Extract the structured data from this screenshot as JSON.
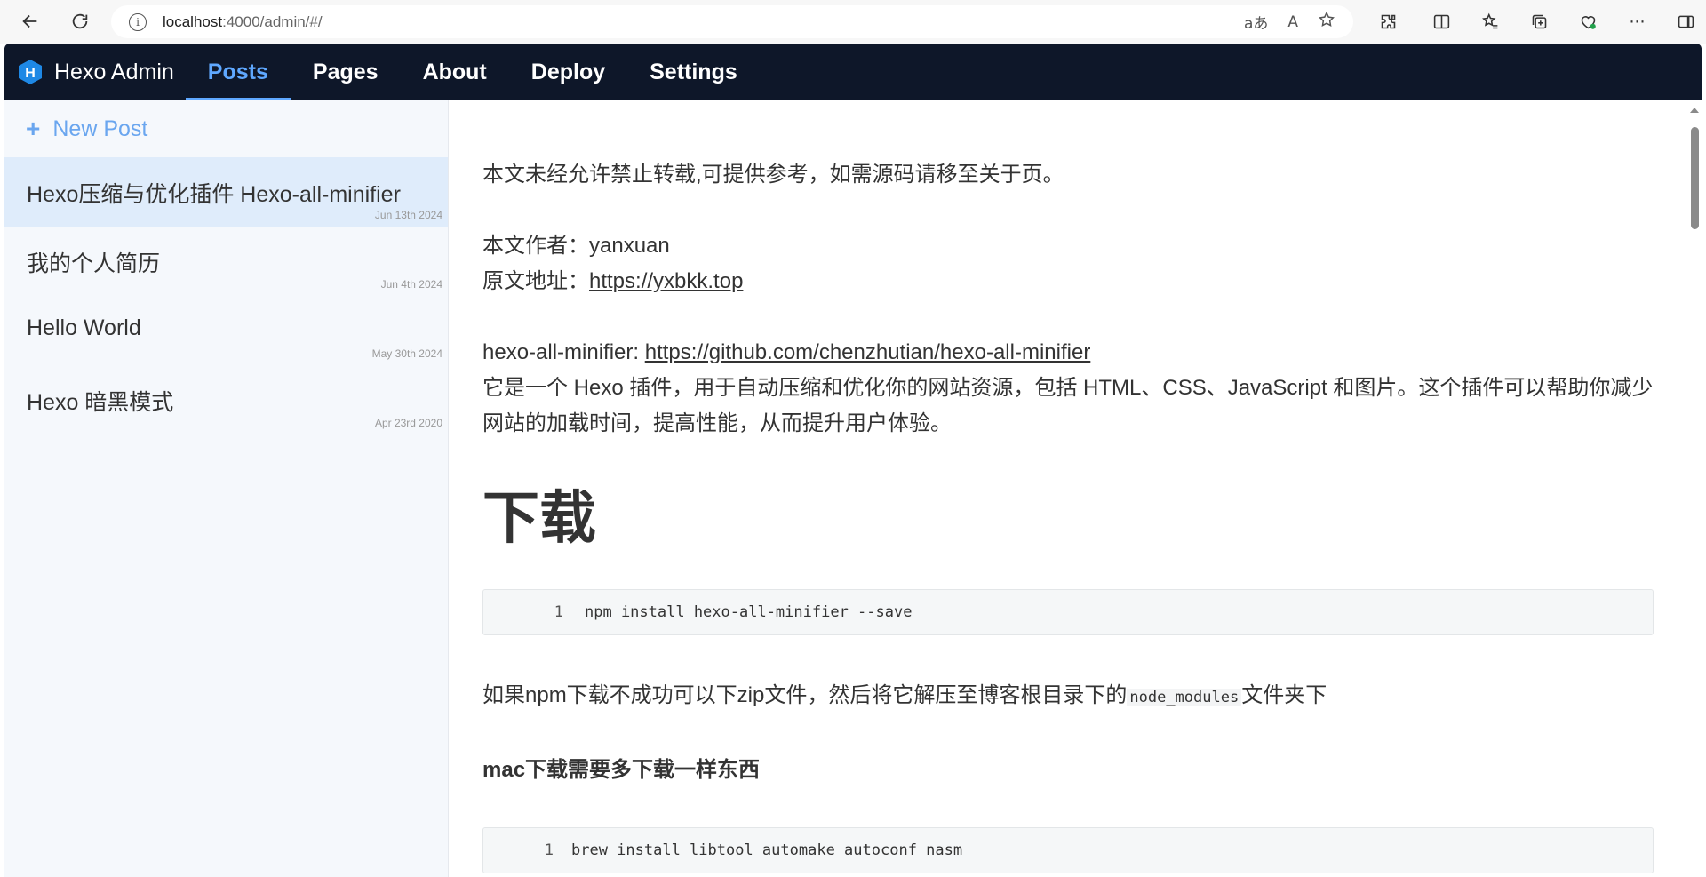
{
  "browser": {
    "url_host": "localhost",
    "url_rest": ":4000/admin/#/",
    "icons": [
      "back-icon",
      "refresh-icon",
      "info-icon",
      "translate-icon",
      "read-aloud-icon",
      "favorite-star-icon",
      "extensions-icon",
      "split-screen-icon",
      "favorites-icon",
      "collections-icon",
      "browser-essentials-icon",
      "more-icon",
      "sidebar-icon"
    ],
    "translate_glyph": "aあ",
    "read_glyph": "A",
    "more_glyph": "···"
  },
  "app": {
    "brand": "Hexo Admin",
    "nav": [
      {
        "label": "Posts",
        "active": true
      },
      {
        "label": "Pages"
      },
      {
        "label": "About"
      },
      {
        "label": "Deploy"
      },
      {
        "label": "Settings"
      }
    ],
    "accent_color": "#5fa8ff",
    "nav_bg": "#0e1729"
  },
  "sidebar": {
    "new_post_icon": "+",
    "new_post_label": "New Post",
    "posts": [
      {
        "title": "Hexo压缩与优化插件 Hexo-all-minifier",
        "date": "Jun 13th 2024",
        "active": true
      },
      {
        "title": "我的个人简历",
        "date": "Jun 4th 2024"
      },
      {
        "title": "Hello World",
        "date": "May 30th 2024"
      },
      {
        "title": "Hexo 暗黑模式",
        "date": "Apr 23rd 2020"
      }
    ]
  },
  "content": {
    "intro": "本文未经允许禁止转载,可提供参考，如需源码请移至关于页。",
    "author_label": "本文作者：",
    "author": "yanxuan",
    "source_label": "原文地址：",
    "source_url": "https://yxbkk.top",
    "plugin_label": "hexo-all-minifier: ",
    "plugin_url": "https://github.com/chenzhutian/hexo-all-minifier",
    "plugin_desc": "它是一个 Hexo 插件，用于自动压缩和优化你的网站资源，包括 HTML、CSS、JavaScript 和图片。这个插件可以帮助你减少网站的加载时间，提高性能，从而提升用户体验。",
    "heading_download": "下载",
    "code1_line": "1",
    "code1": "npm install hexo-all-minifier --save",
    "zip_text_before": "如果npm下载不成功可以下zip文件，然后将它解压至博客根目录下的",
    "zip_code": "node_modules",
    "zip_text_after": "文件夹下",
    "heading_mac": "mac下载需要多下载一样东西",
    "code2_line": "1",
    "code2": "brew install libtool automake autoconf nasm"
  }
}
